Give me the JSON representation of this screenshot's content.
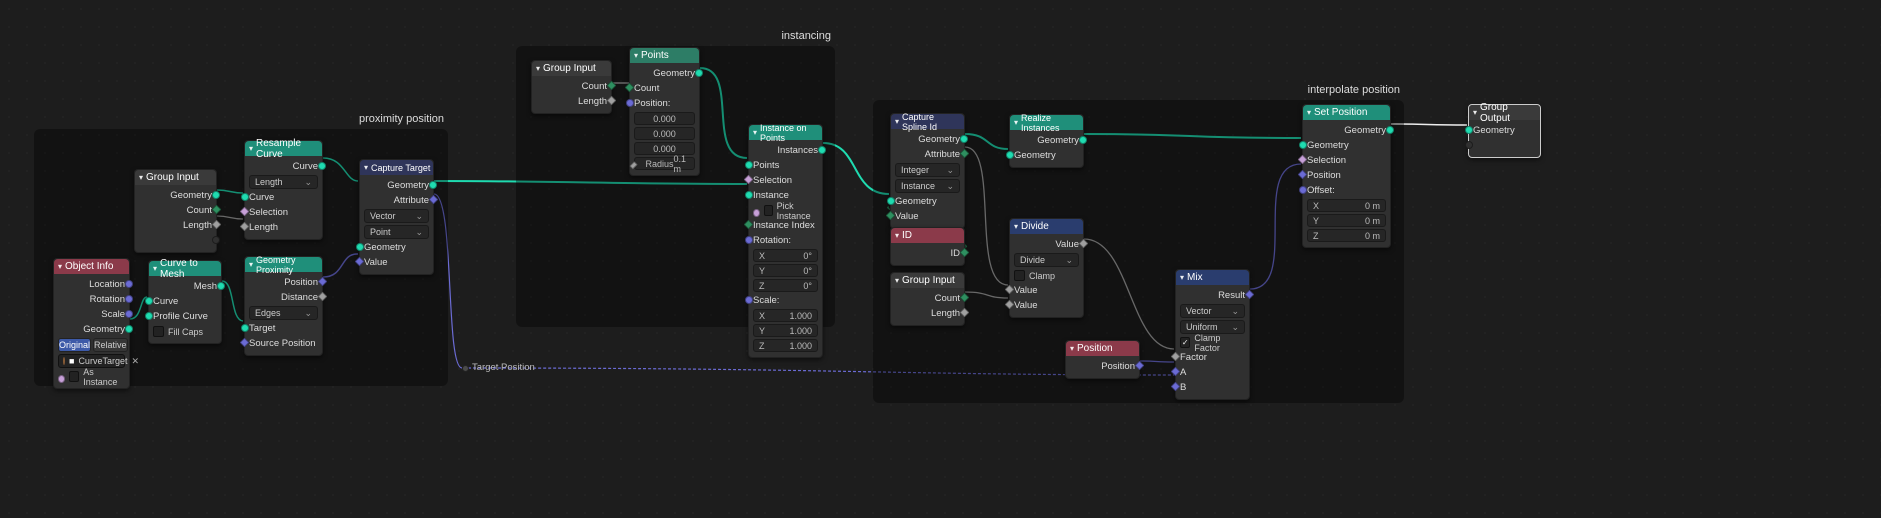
{
  "frames": {
    "proximity": {
      "label": "proximity position"
    },
    "instancing": {
      "label": "instancing"
    },
    "interpolate": {
      "label": "interpolate position"
    }
  },
  "groupInput1": {
    "title": "Group Input",
    "geometry": "Geometry",
    "count": "Count",
    "length": "Length"
  },
  "objectInfo": {
    "title": "Object Info",
    "location": "Location",
    "rotation": "Rotation",
    "scale": "Scale",
    "geometry": "Geometry",
    "original": "Original",
    "relative": "Relative",
    "objectLabel": "CurveTarget",
    "asInstance": "As Instance"
  },
  "curveToMesh": {
    "title": "Curve to Mesh",
    "mesh": "Mesh",
    "curve": "Curve",
    "profile": "Profile Curve",
    "fillCaps": "Fill Caps"
  },
  "resampleCurve": {
    "title": "Resample Curve",
    "curveOut": "Curve",
    "mode": "Length",
    "curveIn": "Curve",
    "selection": "Selection",
    "length": "Length"
  },
  "geometryProximity": {
    "title": "Geometry Proximity",
    "position": "Position",
    "distance": "Distance",
    "mode": "Edges",
    "target": "Target",
    "sourcePosition": "Source Position"
  },
  "captureTarget": {
    "title": "Capture Target Position",
    "geometry": "Geometry",
    "attribute": "Attribute",
    "type": "Vector",
    "domain": "Point",
    "geometryIn": "Geometry",
    "value": "Value"
  },
  "groupInput2": {
    "title": "Group Input",
    "count": "Count",
    "length": "Length"
  },
  "points": {
    "title": "Points",
    "geometry": "Geometry",
    "count": "Count",
    "position": "Position:",
    "x": "0.000",
    "y": "0.000",
    "z": "0.000",
    "radius": "Radius",
    "radiusVal": "0.1 m"
  },
  "instanceOnPoints": {
    "title": "Instance on Points",
    "instances": "Instances",
    "points": "Points",
    "selection": "Selection",
    "instance": "Instance",
    "pickInstance": "Pick Instance",
    "instanceIndex": "Instance Index",
    "rotation": "Rotation:",
    "rx": "X",
    "rxv": "0°",
    "ry": "Y",
    "ryv": "0°",
    "rz": "Z",
    "rzv": "0°",
    "scale": "Scale:",
    "sx": "X",
    "sxv": "1.000",
    "sy": "Y",
    "syv": "1.000",
    "sz": "Z",
    "szv": "1.000"
  },
  "captureSpline": {
    "title": "Capture Spline Id",
    "geometry": "Geometry",
    "attribute": "Attribute",
    "type": "Integer",
    "domain": "Instance",
    "geometryIn": "Geometry",
    "value": "Value"
  },
  "id": {
    "title": "ID",
    "id": "ID"
  },
  "groupInput3": {
    "title": "Group Input",
    "count": "Count",
    "length": "Length"
  },
  "realize": {
    "title": "Realize Instances",
    "geometryOut": "Geometry",
    "geometryIn": "Geometry"
  },
  "divide": {
    "title": "Divide",
    "valueOut": "Value",
    "mode": "Divide",
    "clamp": "Clamp",
    "value1": "Value",
    "value2": "Value"
  },
  "position": {
    "title": "Position",
    "position": "Position"
  },
  "mix": {
    "title": "Mix",
    "result": "Result",
    "dataType": "Vector",
    "blendMode": "Uniform",
    "clampFactor": "Clamp Factor",
    "factor": "Factor",
    "a": "A",
    "b": "B"
  },
  "setPosition": {
    "title": "Set Position",
    "geometryOut": "Geometry",
    "geometryIn": "Geometry",
    "selection": "Selection",
    "position": "Position",
    "offset": "Offset:",
    "ox": "X",
    "oxv": "0 m",
    "oy": "Y",
    "oyv": "0 m",
    "oz": "Z",
    "ozv": "0 m"
  },
  "groupOutput": {
    "title": "Group Output",
    "geometry": "Geometry"
  },
  "reroute": {
    "label": "Target Position"
  }
}
